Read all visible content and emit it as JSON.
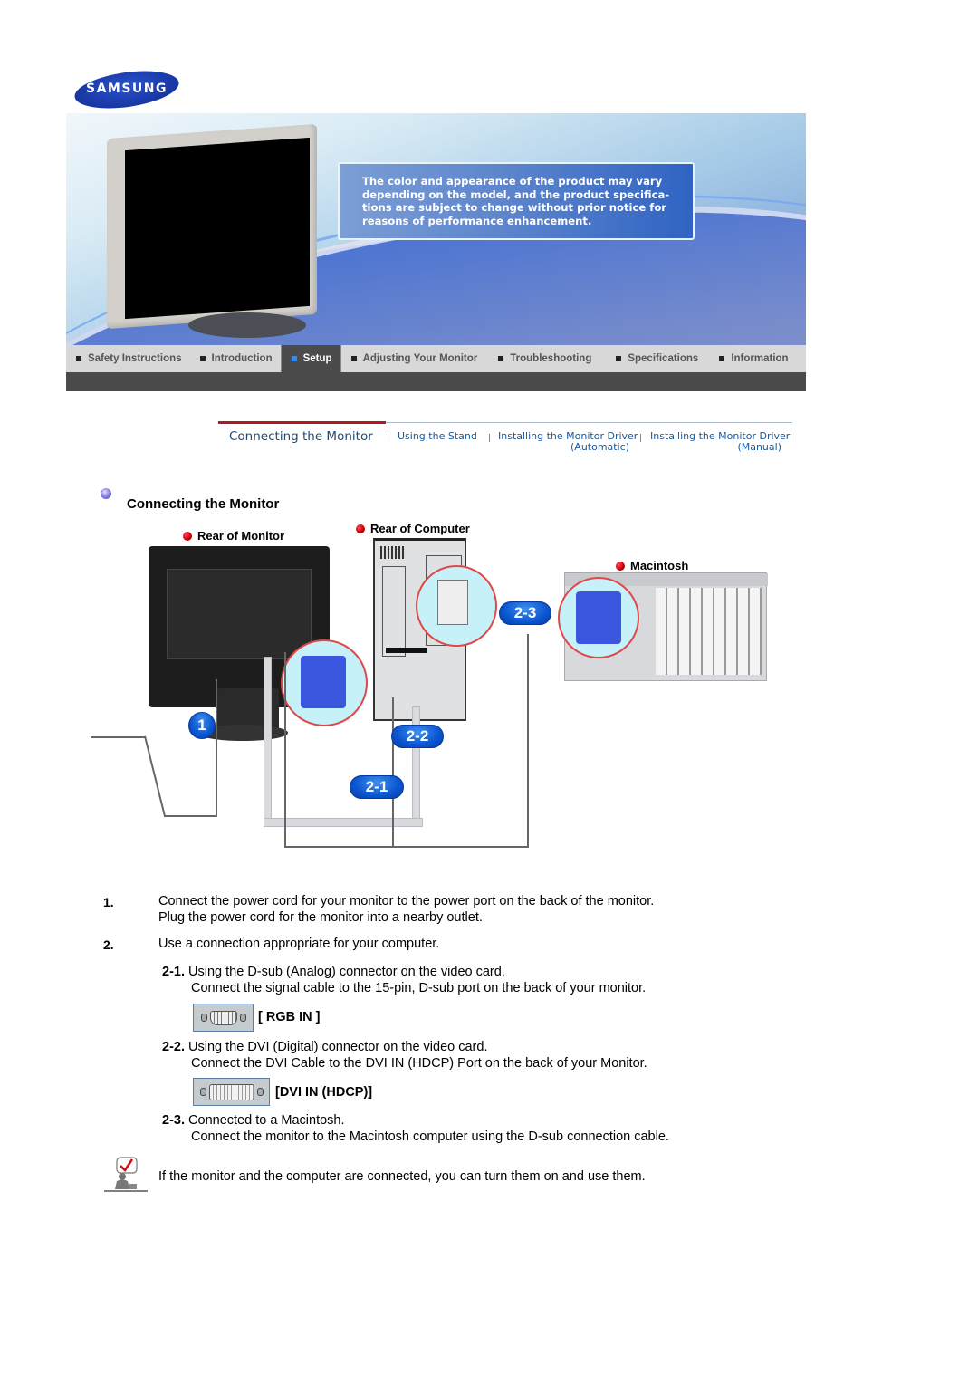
{
  "brand": {
    "logo_text": "SAMSUNG",
    "logo_color": "#1a3aa8"
  },
  "banner": {
    "notice": "The color and appearance of the product may vary\ndepending on the model, and the product specifica-\ntions are subject to change without prior notice for\nreasons of performance enhancement."
  },
  "nav": {
    "items": [
      {
        "label": "Safety Instructions",
        "active": false
      },
      {
        "label": "Introduction",
        "active": false
      },
      {
        "label": "Setup",
        "active": true
      },
      {
        "label": "Adjusting Your Monitor",
        "active": false
      },
      {
        "label": "Troubleshooting",
        "active": false
      },
      {
        "label": "Specifications",
        "active": false
      },
      {
        "label": "Information",
        "active": false
      }
    ],
    "active_color": "#2a8cff"
  },
  "subnav": {
    "items": [
      {
        "label": "Connecting the Monitor",
        "active": true
      },
      {
        "label": "Using the Stand"
      },
      {
        "label": "Installing the Monitor Driver",
        "sublabel": "(Automatic)"
      },
      {
        "label": "Installing the Monitor Driver",
        "sublabel": "(Manual)"
      }
    ]
  },
  "section": {
    "title": "Connecting the Monitor"
  },
  "diagram": {
    "labels": {
      "rear_monitor": "Rear of Monitor",
      "rear_computer": "Rear of Computer",
      "macintosh": "Macintosh"
    },
    "badges": {
      "b1": "1",
      "b21": "2-1",
      "b22": "2-2",
      "b23": "2-3"
    }
  },
  "steps": [
    {
      "num": "1.",
      "lines": [
        "Connect the power cord for your monitor to the power port on the back of the monitor.",
        "Plug the power cord for the monitor into a nearby outlet."
      ]
    },
    {
      "num": "2.",
      "lines": [
        "Use a connection appropriate for your computer."
      ]
    }
  ],
  "substeps": [
    {
      "num": "2-1.",
      "line1": "Using the D-sub (Analog) connector on the video card.",
      "line2": "Connect the signal cable to the 15-pin, D-sub port on the back of your monitor.",
      "port_label": "[ RGB IN ]",
      "port_icon": "vga-port-icon"
    },
    {
      "num": "2-2.",
      "line1": "Using the DVI (Digital) connector on the video card.",
      "line2": "Connect the DVI Cable to the DVI IN (HDCP) Port on the back of your Monitor.",
      "port_label": "[DVI IN (HDCP)]",
      "port_icon": "dvi-port-icon"
    },
    {
      "num": "2-3.",
      "line1": "Connected to a Macintosh.",
      "line2": "Connect the monitor to the Macintosh computer using the D-sub connection cable."
    }
  ],
  "note": {
    "icon": "checkmark-note-icon",
    "text": "If the monitor and the computer are connected, you can turn them on and use them."
  }
}
